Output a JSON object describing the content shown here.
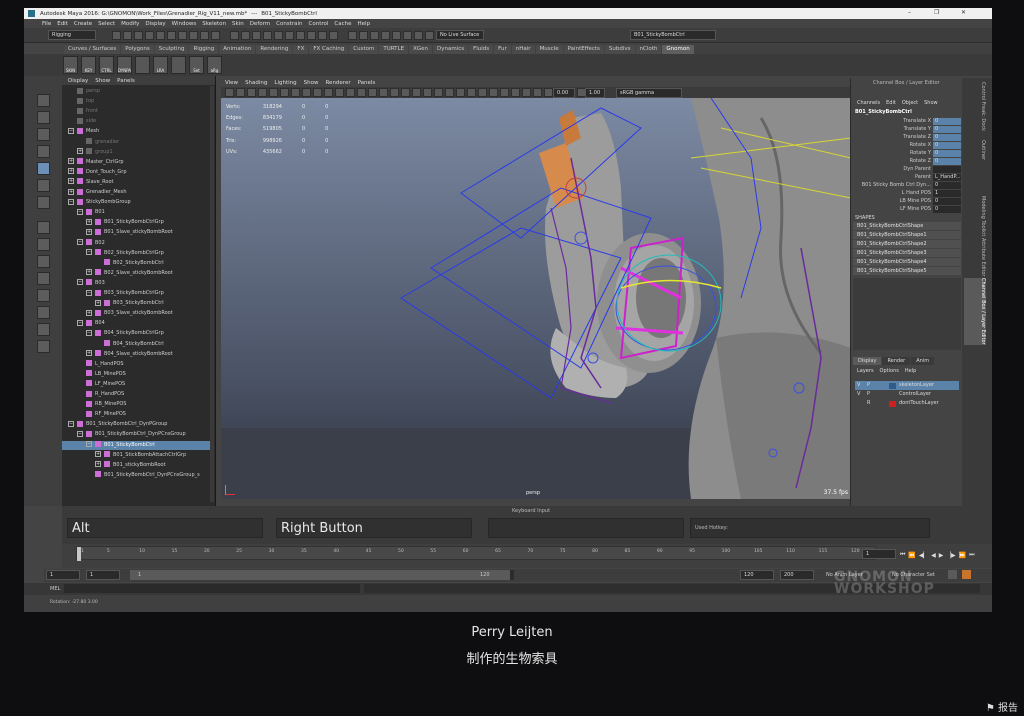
{
  "window": {
    "title": "Autodesk Maya 2016: G:\\GNOMON\\Work_Files\\Grenadier_Rig_V11_new.mb*",
    "separator": "---",
    "object": "B01_StickyBombCtrl",
    "minimize": "–",
    "restore": "❐",
    "close": "✕"
  },
  "menu": [
    "File",
    "Edit",
    "Create",
    "Select",
    "Modify",
    "Display",
    "Windows",
    "Skeleton",
    "Skin",
    "Deform",
    "Constrain",
    "Control",
    "Cache",
    "Help"
  ],
  "status_line": {
    "mode": "Rigging",
    "live_surface": "No Live Surface",
    "name_field": "B01_StickyBombCtrl"
  },
  "shelf_tabs": [
    "Curves / Surfaces",
    "Polygons",
    "Sculpting",
    "Rigging",
    "Animation",
    "Rendering",
    "FX",
    "FX Caching",
    "Custom",
    "TURTLE",
    "XGen",
    "Dynamics",
    "Fluids",
    "Fur",
    "nHair",
    "Muscle",
    "PaintEffects",
    "Subdivs",
    "nCloth",
    "Gnomon"
  ],
  "active_shelf_tab": "Gnomon",
  "shelf_icons": [
    "SKIN",
    "KEY",
    "CTRL",
    "DYNPA",
    "",
    "LRA",
    "",
    "Set",
    "aRg"
  ],
  "outliner": {
    "menu": [
      "Display",
      "Show",
      "Panels"
    ],
    "items": [
      {
        "label": "persp",
        "indent": 0,
        "dim": true,
        "expander": ""
      },
      {
        "label": "top",
        "indent": 0,
        "dim": true,
        "expander": ""
      },
      {
        "label": "front",
        "indent": 0,
        "dim": true,
        "expander": ""
      },
      {
        "label": "side",
        "indent": 0,
        "dim": true,
        "expander": ""
      },
      {
        "label": "Mesh",
        "indent": 0,
        "expander": "−"
      },
      {
        "label": "grenadier",
        "indent": 1,
        "dim": true,
        "expander": ""
      },
      {
        "label": "group1",
        "indent": 1,
        "dim": true,
        "expander": "+"
      },
      {
        "label": "Master_CtrlGrp",
        "indent": 0,
        "expander": "+"
      },
      {
        "label": "Dont_Touch_Grp",
        "indent": 0,
        "expander": "+"
      },
      {
        "label": "Slave_Root",
        "indent": 0,
        "expander": "+"
      },
      {
        "label": "Grenadier_Mesh",
        "indent": 0,
        "expander": "+"
      },
      {
        "label": "StickyBombGroup",
        "indent": 0,
        "expander": "−"
      },
      {
        "label": "B01",
        "indent": 1,
        "expander": "−"
      },
      {
        "label": "B01_StickyBombCtrlGrp",
        "indent": 2,
        "expander": "+"
      },
      {
        "label": "B01_Slave_stickyBombRoot",
        "indent": 2,
        "expander": "+"
      },
      {
        "label": "B02",
        "indent": 1,
        "expander": "−"
      },
      {
        "label": "B02_StickyBombCtrlGrp",
        "indent": 2,
        "expander": "−"
      },
      {
        "label": "B02_StickyBombCtrl",
        "indent": 3,
        "expander": ""
      },
      {
        "label": "B02_Slave_stickyBombRoot",
        "indent": 2,
        "expander": "+"
      },
      {
        "label": "B03",
        "indent": 1,
        "expander": "−"
      },
      {
        "label": "B03_StickyBombCtrlGrp",
        "indent": 2,
        "expander": "−"
      },
      {
        "label": "B03_StickyBombCtrl",
        "indent": 3,
        "expander": "+"
      },
      {
        "label": "B03_Slave_stickyBombRoot",
        "indent": 2,
        "expander": "+"
      },
      {
        "label": "B04",
        "indent": 1,
        "expander": "−"
      },
      {
        "label": "B04_StickyBombCtrlGrp",
        "indent": 2,
        "expander": "−"
      },
      {
        "label": "B04_StickyBombCtrl",
        "indent": 3,
        "expander": ""
      },
      {
        "label": "B04_Slave_stickyBombRoot",
        "indent": 2,
        "expander": "+"
      },
      {
        "label": "L_HandPOS",
        "indent": 1,
        "expander": ""
      },
      {
        "label": "LB_MinePOS",
        "indent": 1,
        "expander": ""
      },
      {
        "label": "LF_MinePOS",
        "indent": 1,
        "expander": ""
      },
      {
        "label": "R_HandPOS",
        "indent": 1,
        "expander": ""
      },
      {
        "label": "RB_MinePOS",
        "indent": 1,
        "expander": ""
      },
      {
        "label": "RF_MinePOS",
        "indent": 1,
        "expander": ""
      },
      {
        "label": "B01_StickyBombCtrl_DynPGroup",
        "indent": 0,
        "expander": "−"
      },
      {
        "label": "B01_StickyBombCtrl_DynPCnsGroup",
        "indent": 1,
        "expander": "−"
      },
      {
        "label": "B01_StickyBombCtrl",
        "indent": 2,
        "expander": "−",
        "selected": true
      },
      {
        "label": "B01_StickBombAttachCtrlGrp",
        "indent": 3,
        "expander": "+"
      },
      {
        "label": "B01_stickyBombRoot",
        "indent": 3,
        "expander": "+"
      },
      {
        "label": "B01_StickyBombCtrl_DynPCnsGroup_s",
        "indent": 2,
        "expander": ""
      }
    ]
  },
  "viewport": {
    "menu": [
      "View",
      "Shading",
      "Lighting",
      "Show",
      "Renderer",
      "Panels"
    ],
    "exposure": "0.00",
    "gamma": "1.00",
    "color_space": "sRGB gamma",
    "hud": [
      {
        "label": "Verts:",
        "a": "318294",
        "b": "0",
        "c": "0"
      },
      {
        "label": "Edges:",
        "a": "834179",
        "b": "0",
        "c": "0"
      },
      {
        "label": "Faces:",
        "a": "519805",
        "b": "0",
        "c": "0"
      },
      {
        "label": "Tris:",
        "a": "998926",
        "b": "0",
        "c": "0"
      },
      {
        "label": "UVs:",
        "a": "435662",
        "b": "0",
        "c": "0"
      }
    ],
    "camera": "persp",
    "fps": "37.5 fps"
  },
  "channel_box": {
    "header": "Channel Box / Layer Editor",
    "menu": [
      "Channels",
      "Edit",
      "Object",
      "Show"
    ],
    "object": "B01_StickyBombCtrl",
    "attrs": [
      {
        "name": "Translate X",
        "value": "0"
      },
      {
        "name": "Translate Y",
        "value": "0"
      },
      {
        "name": "Translate Z",
        "value": "0"
      },
      {
        "name": "Rotate X",
        "value": "0"
      },
      {
        "name": "Rotate Y",
        "value": "0"
      },
      {
        "name": "Rotate Z",
        "value": "0"
      },
      {
        "name": "Dyn Parent",
        "value": ""
      },
      {
        "name": "Parent",
        "value": "L_HandP..."
      },
      {
        "name": "B01 Sticky Bomb Ctrl Dyn...",
        "value": "0"
      },
      {
        "name": "L Hand POS",
        "value": "1"
      },
      {
        "name": "LB Mine POS",
        "value": "0"
      },
      {
        "name": "LF Mine POS",
        "value": "0"
      }
    ],
    "shapes_label": "SHAPES",
    "shapes": [
      "B01_StickyBombCtrlShape",
      "B01_StickyBombCtrlShape1",
      "B01_StickyBombCtrlShape2",
      "B01_StickyBombCtrlShape3",
      "B01_StickyBombCtrlShape4",
      "B01_StickyBombCtrlShape5"
    ],
    "layer_tabs": [
      "Display",
      "Render",
      "Anim"
    ],
    "layer_menu": [
      "Layers",
      "Options",
      "Help"
    ],
    "layers": [
      {
        "v": "V",
        "p": "P",
        "name": "skeletonLayer",
        "color": "#2f5a8a",
        "selected": true
      },
      {
        "v": "V",
        "p": "P",
        "name": "ControlLayer",
        "color": "",
        "selected": false
      },
      {
        "v": "",
        "p": "R",
        "name": "dontTouchLayer",
        "color": "#cc2020",
        "selected": false
      }
    ]
  },
  "side_tabs": [
    "Control Freak: Dock",
    "Outliner",
    "Modeling Toolkit",
    "Attribute Editor",
    "Channel Box / Layer Editor"
  ],
  "keyboard_input": {
    "title": "Keyboard Input",
    "key": "Alt",
    "mouse": "Right Button",
    "extra": "",
    "used_hotkey_label": "Used Hotkey:"
  },
  "timeline": {
    "ticks": [
      "1",
      "5",
      "10",
      "15",
      "20",
      "25",
      "30",
      "35",
      "40",
      "45",
      "50",
      "55",
      "60",
      "65",
      "70",
      "75",
      "80",
      "85",
      "90",
      "95",
      "100",
      "105",
      "110",
      "115",
      "120"
    ],
    "current": "1"
  },
  "range": {
    "start": "1",
    "start2": "1",
    "slider_start": "1",
    "slider_end": "120",
    "end": "120",
    "end2": "200",
    "anim_layer": "No Anim Layer",
    "char_set": "No Character Set"
  },
  "mel": {
    "label": "MEL"
  },
  "help_line": {
    "text": "Rotation: -27.80   3.00"
  },
  "watermark": "GNOMON WORKSHOP",
  "caption": {
    "author": "Perry Leijten",
    "subtitle": "制作的生物索具"
  },
  "report": "报告"
}
